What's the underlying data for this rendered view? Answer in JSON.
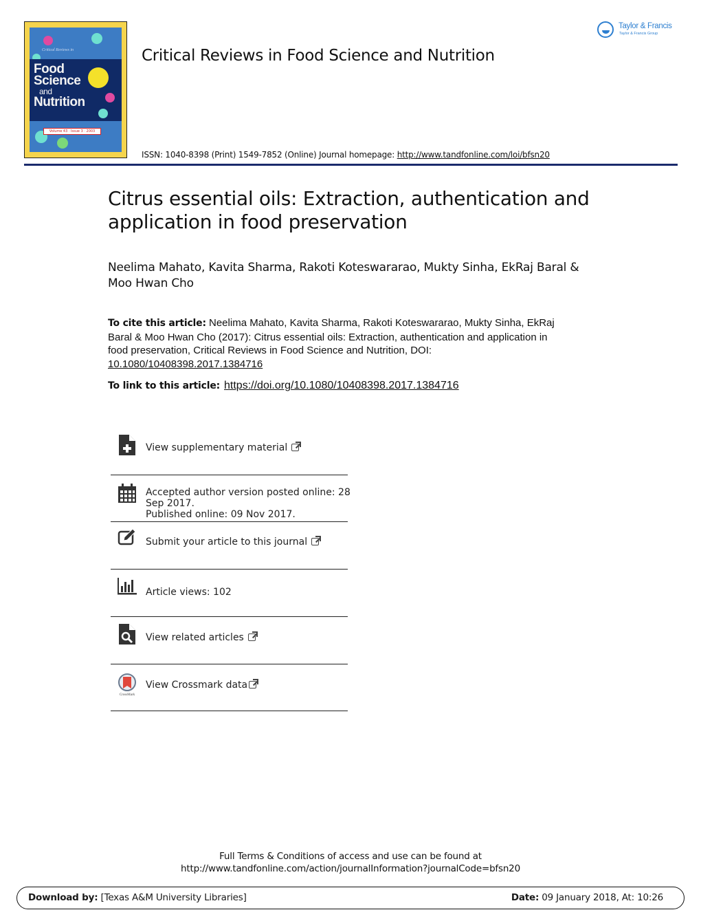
{
  "header": {
    "cover": {
      "series_small": "Critical Reviews in",
      "title_line1": "Food",
      "title_line2": "Science",
      "title_line3": "and",
      "title_line4": "Nutrition",
      "volume_strip": "Volume 43 · Issue 3 · 2003"
    },
    "publisher_logo": {
      "name": "Taylor & Francis",
      "group": "Taylor & Francis Group",
      "icon": "lamp-icon",
      "color": "#2d7fd0"
    },
    "journal_title": "Critical Reviews in Food Science and Nutrition",
    "issn_text": "ISSN: 1040-8398 (Print) 1549-7852 (Online) Journal homepage: ",
    "homepage_link": "http://www.tandfonline.com/loi/bfsn20",
    "rule_color": "#1a2a6c"
  },
  "article": {
    "title": "Citrus essential oils: Extraction, authentication and application in food preservation",
    "authors": "Neelima Mahato, Kavita Sharma, Rakoti Koteswararao, Mukty Sinha, EkRaj Baral & Moo Hwan Cho",
    "cite_label": "To cite this article:",
    "cite_text": " Neelima Mahato, Kavita Sharma, Rakoti Koteswararao, Mukty Sinha, EkRaj Baral & Moo Hwan Cho (2017): Citrus essential oils: Extraction, authentication and application in food preservation, Critical Reviews in Food Science and Nutrition, DOI: ",
    "cite_doi": "10.1080/10408398.2017.1384716",
    "link_label": "To link to this article:",
    "link_url": "https://doi.org/10.1080/10408398.2017.1384716"
  },
  "actions": [
    {
      "icon": "supplementary-file-icon",
      "label": "View supplementary material",
      "external": true
    },
    {
      "icon": "calendar-icon",
      "label_line1": "Accepted author version posted online: 28",
      "label_line2": "Sep 2017.",
      "label_line3": "Published online: 09 Nov 2017.",
      "external": false
    },
    {
      "icon": "edit-icon",
      "label": "Submit your article to this journal",
      "external": true
    },
    {
      "icon": "bar-chart-icon",
      "label": "Article views: 102",
      "external": false
    },
    {
      "icon": "search-document-icon",
      "label": "View related articles",
      "external": true
    },
    {
      "icon": "crossmark-icon",
      "icon_caption": "CrossMark",
      "label": "View Crossmark data",
      "external": true
    }
  ],
  "footer": {
    "terms_line1": "Full Terms & Conditions of access and use can be found at",
    "terms_line2": "http://www.tandfonline.com/action/journalInformation?journalCode=bfsn20",
    "download_label": "Download by:",
    "download_value": " [Texas A&M University Libraries]",
    "date_label": "Date:",
    "date_value": " 09 January 2018, At: 10:26"
  }
}
